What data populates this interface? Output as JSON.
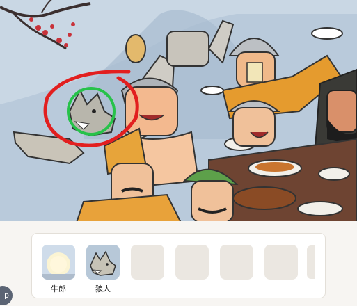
{
  "scene": {
    "description_icons": [
      "plum-blossom-branch",
      "feast-crowd",
      "wolf-head-character",
      "red-circle-mark",
      "green-circle-mark"
    ]
  },
  "found_items": [
    {
      "label": "牛郎",
      "icon": "moon-icon"
    },
    {
      "label": "狼人",
      "icon": "wolf-icon"
    }
  ],
  "empty_slot_count": 4,
  "corner_badge": {
    "text": "p"
  },
  "colors": {
    "sky": "#b7c8d8",
    "marker_red": "#e21f1f",
    "marker_green": "#27c24a",
    "tray_bg": "#f7f5f2",
    "slot_empty": "#ebe7e1"
  }
}
